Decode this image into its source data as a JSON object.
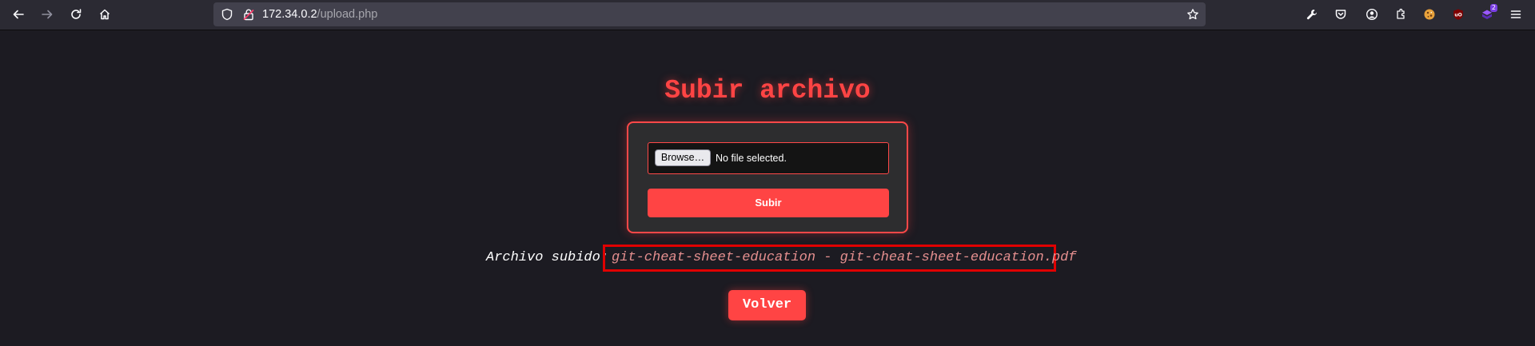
{
  "browser": {
    "url_host": "172.34.0.2",
    "url_path": "/upload.php",
    "extension_badge": "2"
  },
  "page": {
    "title": "Subir archivo",
    "upload_form": {
      "browse_label": "Browse…",
      "file_status": "No file selected.",
      "submit_label": "Subir"
    },
    "result": {
      "label": "Archivo subido:",
      "filename": "git-cheat-sheet-education - git-cheat-sheet-education.pdf"
    },
    "back_label": "Volver"
  },
  "colors": {
    "accent": "#ff4444",
    "background": "#1c1b22",
    "highlight_border": "#e00000"
  }
}
